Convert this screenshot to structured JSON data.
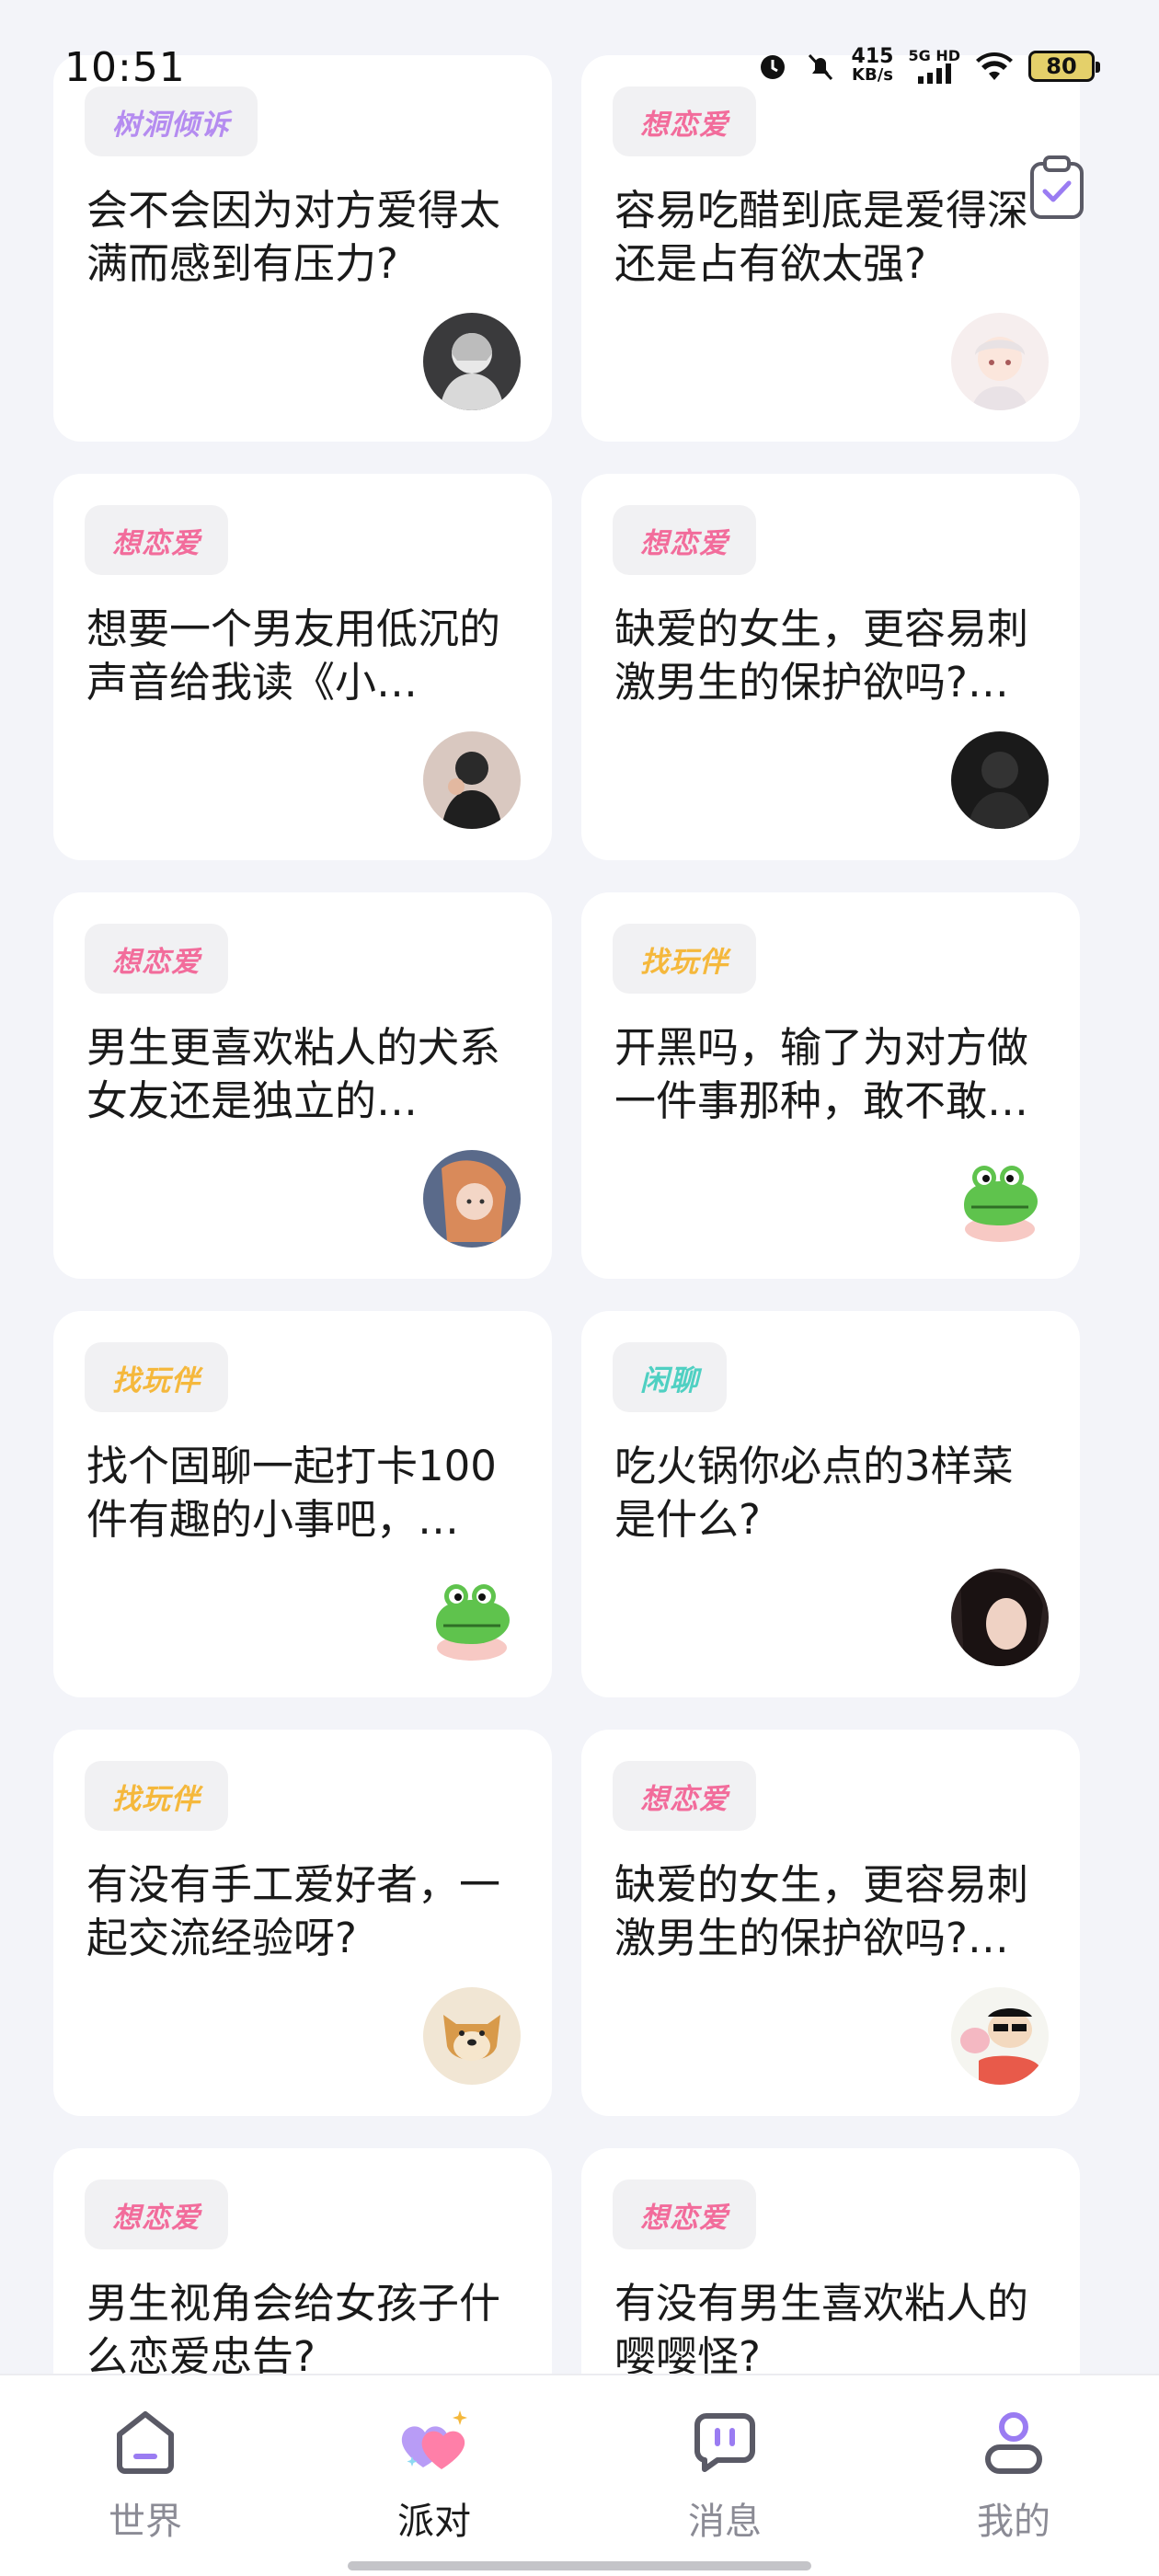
{
  "status_bar": {
    "time": "10:51",
    "net_speed": "415",
    "net_unit": "KB/s",
    "signal_label_top": "5G HD",
    "battery": "80"
  },
  "cards": [
    {
      "tag": "树洞倾诉",
      "tag_color": "#b58cf0",
      "title": "会不会因为对方爱得太满而感到有压力?"
    },
    {
      "tag": "想恋爱",
      "tag_color": "#f26c9b",
      "title": "容易吃醋到底是爱得深还是占有欲太强?"
    },
    {
      "tag": "想恋爱",
      "tag_color": "#f26c9b",
      "title": "想要一个男友用低沉的声音给我读《小…"
    },
    {
      "tag": "想恋爱",
      "tag_color": "#f26c9b",
      "title": "缺爱的女生，更容易刺激男生的保护欲吗?…"
    },
    {
      "tag": "想恋爱",
      "tag_color": "#f26c9b",
      "title": "男生更喜欢粘人的犬系女友还是独立的…"
    },
    {
      "tag": "找玩伴",
      "tag_color": "#f5b83c",
      "title": "开黑吗，输了为对方做一件事那种，敢不敢…"
    },
    {
      "tag": "找玩伴",
      "tag_color": "#f5b83c",
      "title": "找个固聊一起打卡100件有趣的小事吧，…"
    },
    {
      "tag": "闲聊",
      "tag_color": "#4fd0c2",
      "title": "吃火锅你必点的3样菜是什么?"
    },
    {
      "tag": "找玩伴",
      "tag_color": "#f5b83c",
      "title": "有没有手工爱好者，一起交流经验呀?"
    },
    {
      "tag": "想恋爱",
      "tag_color": "#f26c9b",
      "title": "缺爱的女生，更容易刺激男生的保护欲吗?…"
    },
    {
      "tag": "想恋爱",
      "tag_color": "#f26c9b",
      "title": "男生视角会给女孩子什么恋爱忠告?"
    },
    {
      "tag": "想恋爱",
      "tag_color": "#f26c9b",
      "title": "有没有男生喜欢粘人的嘤嘤怪?"
    }
  ],
  "tabs": [
    {
      "label": "世界",
      "icon": "home-icon"
    },
    {
      "label": "派对",
      "icon": "party-hearts-icon",
      "active": true
    },
    {
      "label": "消息",
      "icon": "message-icon"
    },
    {
      "label": "我的",
      "icon": "profile-icon"
    }
  ]
}
